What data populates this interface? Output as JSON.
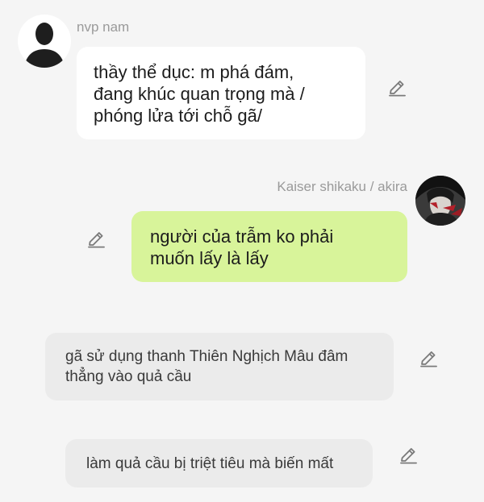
{
  "messages": [
    {
      "sender": "nvp nam",
      "lines": [
        "thầy thể dục: m phá đám,",
        "đang khúc quan trọng mà /",
        "phóng lửa tới chỗ gã/"
      ],
      "avatar_icon": "silhouette-avatar-icon",
      "edit_icon": "pencil-icon"
    },
    {
      "sender": "Kaiser shikaku / akira",
      "lines": [
        "người của trẫm ko phải",
        "muốn lấy là lấy"
      ],
      "avatar_icon": "anime-avatar-icon",
      "edit_icon": "pencil-icon"
    },
    {
      "lines": [
        "gã sử dụng thanh Thiên Nghịch Mâu đâm",
        "thẳng vào quả cầu"
      ],
      "edit_icon": "pencil-icon"
    },
    {
      "lines": [
        "làm quả cầu bị triệt tiêu mà biến mất"
      ],
      "edit_icon": "pencil-icon"
    }
  ],
  "colors": {
    "background": "#f5f5f5",
    "bubble_white": "#ffffff",
    "bubble_green": "#d8f49a",
    "bubble_gray": "#ebebeb",
    "name_text": "#9a9a9a"
  }
}
